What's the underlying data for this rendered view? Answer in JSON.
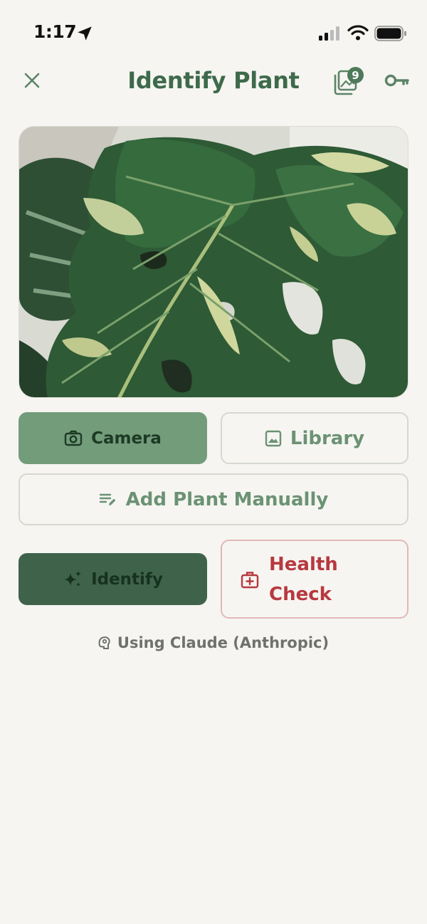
{
  "status_bar": {
    "time": "1:17"
  },
  "nav": {
    "title": "Identify Plant",
    "history_count": "9",
    "icons": {
      "close": "close-icon",
      "history": "photo-stack-icon",
      "key": "key-icon"
    }
  },
  "photo": {
    "subject": "variegated monstera leaf photo"
  },
  "actions": {
    "camera_label": "Camera",
    "library_label": "Library",
    "manual_label": "Add Plant Manually",
    "identify_label": "Identify",
    "health_label": "Health Check"
  },
  "footer": {
    "provider_text": "Using Claude (Anthropic)"
  },
  "colors": {
    "background": "#f6f5f1",
    "primary_green": "#3e6a4b",
    "camera_bg": "#739c7b",
    "identify_bg": "#3f634a",
    "health_red": "#b7393f"
  }
}
